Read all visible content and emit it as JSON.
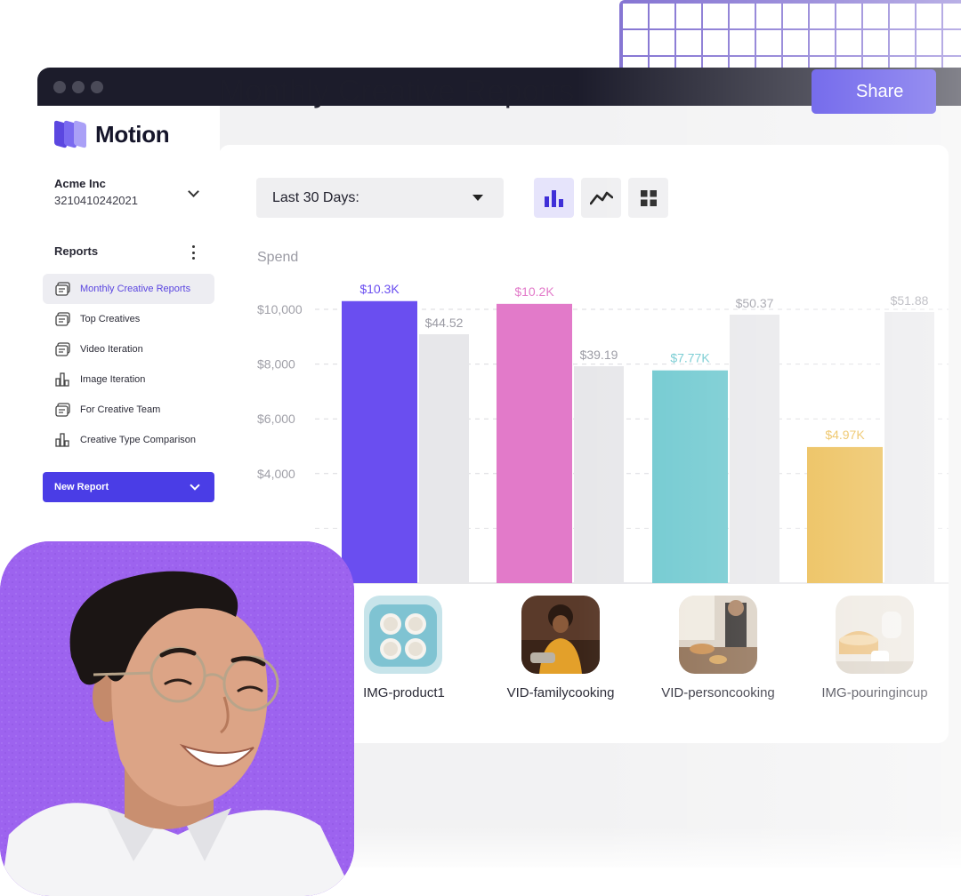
{
  "brand": {
    "name": "Motion",
    "accent": "#4a3de6"
  },
  "account": {
    "name": "Acme Inc",
    "id": "3210410242021"
  },
  "sidebar": {
    "section_title": "Reports",
    "items": [
      {
        "label": "Monthly Creative Reports",
        "icon": "report-icon",
        "active": true
      },
      {
        "label": "Top Creatives",
        "icon": "report-icon"
      },
      {
        "label": "Video Iteration",
        "icon": "report-icon"
      },
      {
        "label": "Image Iteration",
        "icon": "bar-report-icon"
      },
      {
        "label": "For Creative Team",
        "icon": "report-icon"
      },
      {
        "label": "Creative Type Comparison",
        "icon": "bar-report-icon"
      }
    ],
    "new_report_label": "New Report"
  },
  "header": {
    "title": "Monthly Creative Reports",
    "share_label": "Share"
  },
  "filters": {
    "range_label": "Last 30 Days:"
  },
  "views": [
    "bar-chart-icon",
    "line-chart-icon",
    "grid-icon"
  ],
  "chart_data": {
    "type": "bar",
    "ylabel": "Spend",
    "ytick_labels": [
      "$10,000",
      "$8,000",
      "$6,000",
      "$4,000"
    ],
    "y_ticks": [
      10000,
      8000,
      6000,
      4000
    ],
    "ylim": [
      0,
      11000
    ],
    "grid": true,
    "categories": [
      "IMG-product1",
      "VID-familycooking",
      "VID-personcooking",
      "IMG-pouringincup"
    ],
    "series": [
      {
        "values": [
          10300,
          10200,
          7770,
          4970
        ],
        "labels": [
          "$10.3K",
          "$10.2K",
          "$7.77K",
          "$4.97K"
        ],
        "colors": [
          "#6a4ef0",
          "#e27ac9",
          "#6dc8cf",
          "#e9b43c"
        ]
      },
      {
        "values": [
          44.52,
          39.19,
          50.37,
          51.88
        ],
        "labels": [
          "$44.52",
          "$39.19",
          "$50.37",
          "$51.88"
        ],
        "color": "#e7e7ea"
      }
    ]
  }
}
